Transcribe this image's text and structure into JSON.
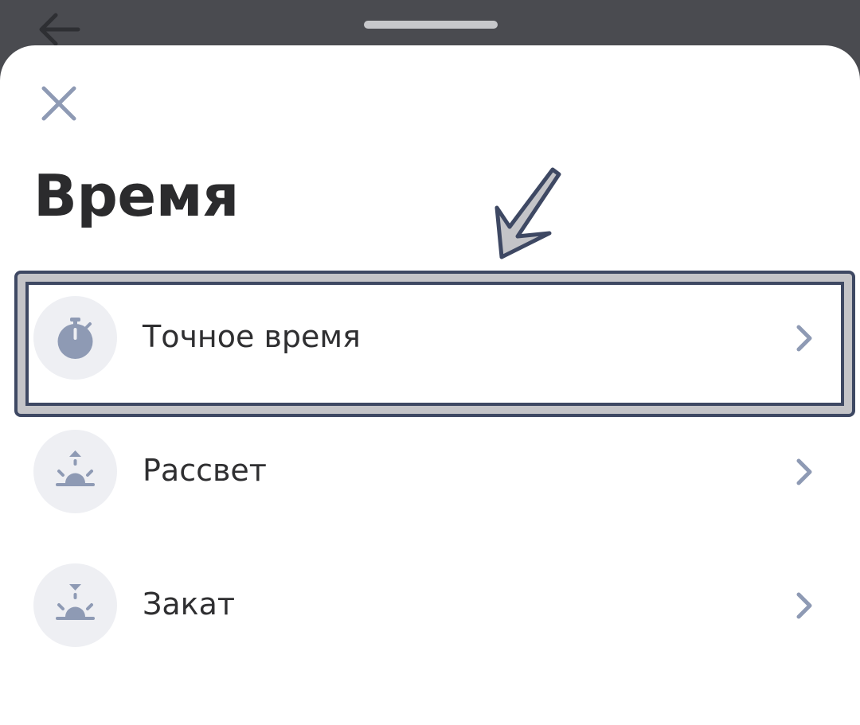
{
  "header": {
    "back_icon": "arrow-left-icon",
    "grabber": "sheet-grabber"
  },
  "sheet": {
    "close_icon": "close-icon",
    "title": "Время"
  },
  "items": [
    {
      "label": "Точное время",
      "icon": "stopwatch-icon",
      "chevron": "chevron-right-icon",
      "highlighted": true
    },
    {
      "label": "Рассвет",
      "icon": "sunrise-icon",
      "chevron": "chevron-right-icon",
      "highlighted": false
    },
    {
      "label": "Закат",
      "icon": "sunset-icon",
      "chevron": "chevron-right-icon",
      "highlighted": false
    }
  ],
  "colors": {
    "topbar": "#4a4b50",
    "sheet": "#ffffff",
    "icon_fill": "#8e9ab4",
    "icon_bg": "#eeeff3",
    "text": "#2f2f31",
    "highlight_border": "#3e4863",
    "highlight_fill": "#c4c4c8"
  }
}
